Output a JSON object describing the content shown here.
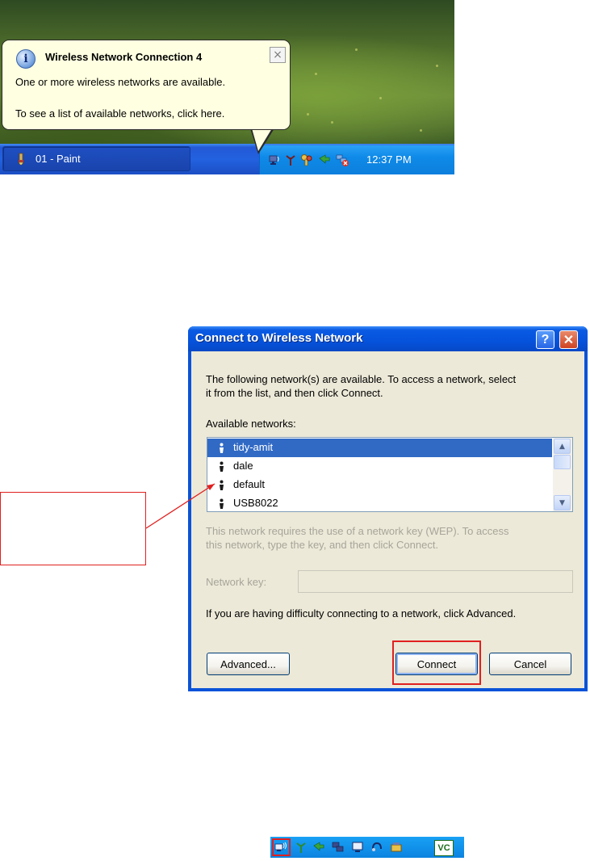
{
  "balloon": {
    "title": "Wireless Network Connection 4",
    "line1": "One or more wireless networks are available.",
    "line2": "To see a list of available networks, click here.",
    "close_glyph": "×",
    "info_glyph": "i"
  },
  "taskbar": {
    "task_label": "01 - Paint",
    "clock": "12:37 PM",
    "tray_icons": [
      "wireless-network-icon",
      "antenna-icon",
      "keys-icon",
      "green-arrows-icon",
      "network-disconnected-icon"
    ]
  },
  "dialog": {
    "title": "Connect to Wireless Network",
    "help_glyph": "?",
    "close_glyph": "✕",
    "intro_line1": "The following network(s) are available. To access a network, select",
    "intro_line2": "it from the list, and then click Connect.",
    "available_label": "Available networks:",
    "networks": [
      "tidy-amit",
      "dale",
      "default",
      "USB8022"
    ],
    "selected_network": "tidy-amit",
    "wep_line1": "This network requires the use of a network key (WEP). To access",
    "wep_line2": "this network, type the key, and then click Connect.",
    "key_label": "Network key:",
    "key_value": "",
    "difficulty": "If you are having difficulty connecting to a network, click Advanced.",
    "advanced_button": "Advanced...",
    "connect_button": "Connect",
    "cancel_button": "Cancel"
  },
  "tray_strip": {
    "icons": [
      "wireless-network-icon",
      "antenna-icon",
      "green-arrows-icon",
      "network-computers-icon",
      "monitor-icon",
      "headset-icon",
      "device-icon",
      "vc-icon"
    ],
    "vc_text": "VC"
  },
  "colors": {
    "xp_blue": "#0553dc",
    "annotation_red": "#e02020",
    "selection": "#316ac5",
    "balloon_bg": "#ffffe1",
    "dialog_bg": "#ece9d8"
  }
}
